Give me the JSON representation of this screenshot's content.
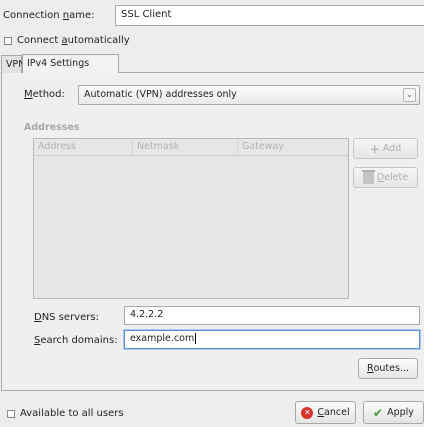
{
  "connection_name": {
    "label_prefix": "Connection ",
    "label_mnemonic": "n",
    "label_suffix": "ame:",
    "value": "SSL Client"
  },
  "connect_automatically": {
    "label_prefix": "Connect ",
    "label_mnemonic": "a",
    "label_suffix": "utomatically",
    "checked": false
  },
  "tabs": [
    {
      "label": "VPN",
      "active": false
    },
    {
      "label": "IPv4 Settings",
      "active": true
    }
  ],
  "method": {
    "label_mnemonic": "M",
    "label_suffix": "ethod:",
    "value": "Automatic (VPN) addresses only",
    "arrow_icon": "chevron-down-icon"
  },
  "addresses": {
    "label": "Addresses",
    "columns": [
      "Address",
      "Netmask",
      "Gateway"
    ],
    "rows": [],
    "add_label": "Add",
    "delete_mnemonic": "D",
    "delete_suffix": "elete"
  },
  "dns": {
    "label_mnemonic": "D",
    "label_suffix": "NS servers:",
    "value": "4.2.2.2"
  },
  "search_domains": {
    "label_mnemonic": "S",
    "label_suffix": "earch domains:",
    "value": "example.com"
  },
  "routes": {
    "label_mnemonic": "R",
    "label_suffix": "outes..."
  },
  "available_all_users": {
    "label": "Available to all users",
    "checked": false
  },
  "buttons": {
    "cancel_mnemonic": "C",
    "cancel_suffix": "ancel",
    "apply_label": "Apply"
  }
}
